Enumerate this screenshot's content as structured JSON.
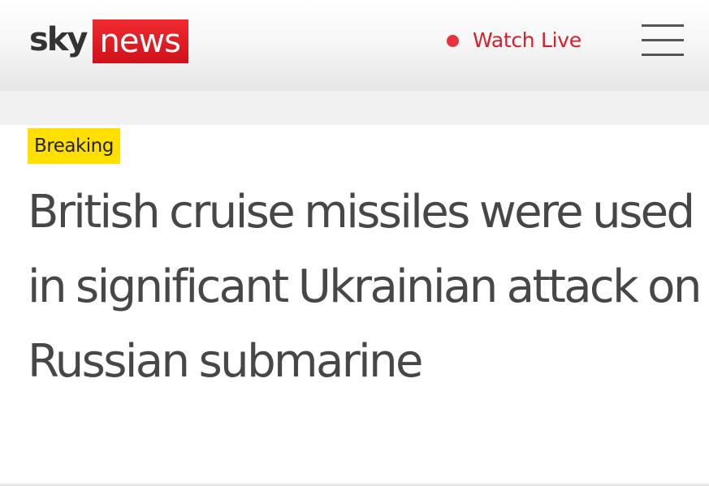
{
  "header": {
    "logo": {
      "brand": "sky",
      "product": "news",
      "colors": {
        "sky_text": "#333333",
        "news_background": "#d0111b",
        "news_text": "#ffffff"
      }
    },
    "watch_live": {
      "label": "Watch Live",
      "icon": "live-dot-icon",
      "color": "#d4202a"
    },
    "menu": {
      "icon": "hamburger-menu-icon"
    }
  },
  "article": {
    "badge": {
      "label": "Breaking",
      "background": "#ffe000"
    },
    "headline": "British cruise missiles were used in significant Ukrainian attack on Russian submarine"
  }
}
